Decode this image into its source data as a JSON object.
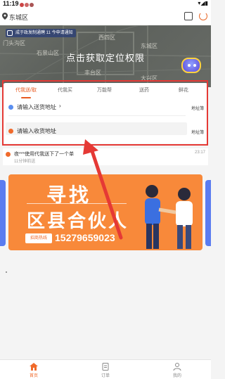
{
  "status_bar": {
    "time": "11:19",
    "right_icons": "▾◢▮"
  },
  "header": {
    "location": "东城区"
  },
  "map": {
    "banner": "成于政发制通聘 11 今申请通知",
    "prompt": "点击获取定位权限",
    "labels": [
      "门头沟区",
      "东城区",
      "石景山区",
      "丰台区",
      "大兴区",
      "西四区"
    ]
  },
  "tabs": [
    {
      "label": "代我送/取",
      "active": true
    },
    {
      "label": "代我买",
      "active": false
    },
    {
      "label": "万能帮",
      "active": false
    },
    {
      "label": "送药",
      "active": false
    },
    {
      "label": "鲜花",
      "active": false
    }
  ],
  "address": {
    "send": {
      "label": "请输入送货地址",
      "chevron": "›",
      "book": "地址簿"
    },
    "receive": {
      "label": "请输入收货地址",
      "chevron": "›",
      "book": "地址簿"
    }
  },
  "notice": {
    "text": "夜***使用代我送下了一个单",
    "sub": "11分钟前送",
    "time": "23:17"
  },
  "banner": {
    "line1": "寻找",
    "line2": "区县合伙人",
    "hotline": "招商热线",
    "phone": "15279659023"
  },
  "bottom_nav": [
    {
      "label": "首页",
      "icon": "home-icon",
      "active": true
    },
    {
      "label": "订单",
      "icon": "order-icon",
      "active": false
    },
    {
      "label": "我的",
      "icon": "profile-icon",
      "active": false
    }
  ],
  "colors": {
    "accent": "#e8591f",
    "highlight_box": "#e53935",
    "banner": "#f8893a"
  }
}
